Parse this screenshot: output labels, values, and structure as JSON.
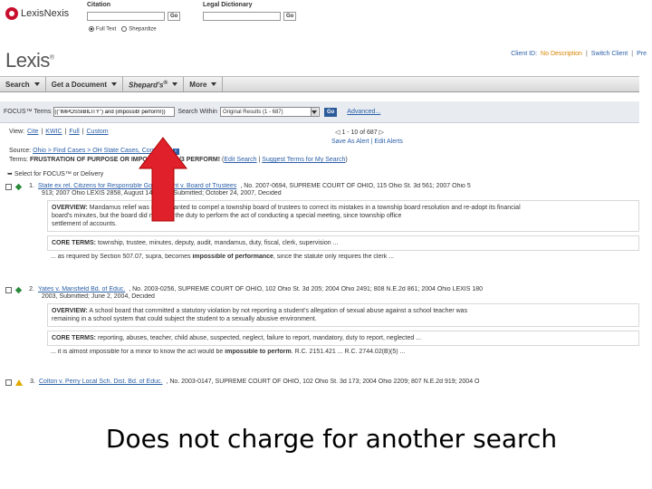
{
  "topbar": {
    "logo": "LexisNexis",
    "citation_label": "Citation",
    "dictionary_label": "Legal Dictionary",
    "go_label": "Go",
    "radio_full_text": "Full Text",
    "radio_shepardize": "Shepardize"
  },
  "header": {
    "lexis": "Lexis",
    "client_id": "Client ID:",
    "no_description": "No Description",
    "switch_client": "Switch Client",
    "preferences": "Pre"
  },
  "nav": {
    "search": "Search",
    "get_document": "Get a Document",
    "shepards": "Shepard's",
    "shepards_sup": "®",
    "more": "More"
  },
  "focus": {
    "label": "FOCUS™ Terms",
    "terms_value": "((\"IMPOSSIBILITY\") and (impossib! perform!))",
    "search_within_label": "Search Within",
    "search_within_value": "Original Results (1 - 687)",
    "go_label": "Go",
    "advanced": "Advanced..."
  },
  "view": {
    "label": "View:",
    "cite": "Cite",
    "kwic": "KWIC",
    "full": "Full",
    "custom": "Custom",
    "pager": "1 - 10 of 687",
    "save_alert": "Save As Alert",
    "edit_alerts": "Edit Alerts",
    "source_label": "Source:",
    "source_value": "Ohio > Find Cases > OH State Cases, Combined",
    "terms_label": "Terms:",
    "terms_value": "FRUSTRATION OF PURPOSE OR IMPOSSIBILITY /3 PERFORM!",
    "edit_search": "Edit Search",
    "suggest_terms": "Suggest Terms for My Search",
    "select_focus": "Select for FOCUS™ or Delivery"
  },
  "results": [
    {
      "number": "1.",
      "title": "State ex rel. Citizens for Responsible Government v. Board of Trustees",
      "cite_line": ", No. 2007-0694, SUPREME COURT OF OHIO, 115 Ohio St. 3d 561; 2007 Ohio 5",
      "cite_line2": "913; 2007 Ohio LEXIS 2858, August 14, 2007, Submitted; October 24, 2007, Decided",
      "overview_label": "OVERVIEW:",
      "overview": [
        "Mandamus relief was not warranted to compel a township board of trustees to correct its mistakes in a township board resolution and re-adopt its financial",
        "board's minutes, but the board did not have the duty to perform the act of conducting a special meeting, since township office",
        "settlement of accounts."
      ],
      "core_label": "CORE TERMS:",
      "core": "township, trustee, minutes, deputy, audit, mandamus, duty, fiscal, clerk, supervision ...",
      "snippet_pre": "... as required by Section 507.07, supra, becomes ",
      "snippet_bold": "impossible of performance",
      "snippet_post": ", since the statute only requires the clerk ..."
    },
    {
      "number": "2.",
      "title": "Yates v. Mansfield Bd. of Educ.",
      "cite_line": ", No. 2003-0256, SUPREME COURT OF OHIO, 102 Ohio St. 3d 205; 2004 Ohio 2491; 808 N.E.2d 861; 2004 Ohio LEXIS 180",
      "cite_line2": "2003, Submitted; June 2, 2004, Decided",
      "overview_label": "OVERVIEW:",
      "overview": [
        "A school board that committed a statutory violation by not reporting a student's allegation of sexual abuse against a school teacher was",
        "remaining in a school system that could subject the student to a sexually abusive environment."
      ],
      "core_label": "CORE TERMS:",
      "core": "reporting, abuses, teacher, child abuse, suspected, neglect, failure to report, mandatory, duty to report, neglected ...",
      "snippet_pre": "... it is almost impossible for a minor to know the act would be ",
      "snippet_bold": "impossible to perform",
      "snippet_post": ". R.C. 2151.421 ... R.C. 2744.02(B)(5) ..."
    },
    {
      "number": "3.",
      "title": "Colton v. Perry Local Sch. Dist. Bd. of Educ.",
      "cite_line": ", No. 2003-0147, SUPREME COURT OF OHIO, 102 Ohio St. 3d 173; 2004 Ohio 2209; 807 N.E.2d 919; 2004 O"
    }
  ],
  "caption": "Does not charge for another search",
  "colors": {
    "link": "#2b5fa8",
    "arrow": "#e0202a",
    "lexis_red": "#c8102e"
  }
}
